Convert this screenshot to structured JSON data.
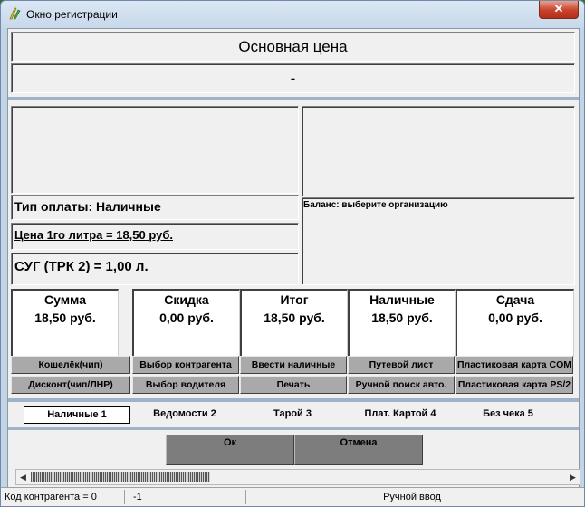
{
  "window": {
    "title": "Окно регистрации",
    "close_label": "✕"
  },
  "header": {
    "price_title": "Основная цена",
    "price_subtitle": "-"
  },
  "payment": {
    "type_label": "Тип оплаты:  Наличные",
    "price_per_liter": "Цена 1го литра = 18,50   руб.",
    "pump_volume": "СУГ (ТРК 2) = 1,00 л."
  },
  "balance": {
    "text": "Баланс: выберите организацию"
  },
  "totals": [
    {
      "title": "Сумма",
      "value": "18,50  руб."
    },
    {
      "title": "Скидка",
      "value": "0,00  руб."
    },
    {
      "title": "Итог",
      "value": "18,50  руб."
    },
    {
      "title": "Наличные",
      "value": "18,50  руб."
    },
    {
      "title": "Сдача",
      "value": "0,00  руб."
    }
  ],
  "actions": {
    "row1": [
      "Кошелёк(чип)",
      "Выбор контрагента",
      "Ввести наличные",
      "Путевой лист",
      "Пластиковая карта COM"
    ],
    "row2": [
      "Дисконт(чип/ЛНР)",
      "Выбор водителя",
      "Печать",
      "Ручной поиск авто.",
      "Пластиковая карта PS/2"
    ]
  },
  "tabs": [
    "Наличные 1",
    "Ведомости 2",
    "Тарой 3",
    "Плат. Картой 4",
    "Без чека 5"
  ],
  "dialog": {
    "ok_label": "Ок",
    "cancel_label": "Отмена"
  },
  "status": {
    "counterparty_code": "Код контрагента = 0",
    "value": "-1",
    "empty": "",
    "input_mode": "Ручной ввод"
  },
  "colors": {
    "accent_bar": "#9fb3c8",
    "button_gray": "#a9a9a9",
    "dialog_button": "#7d7d7d"
  }
}
